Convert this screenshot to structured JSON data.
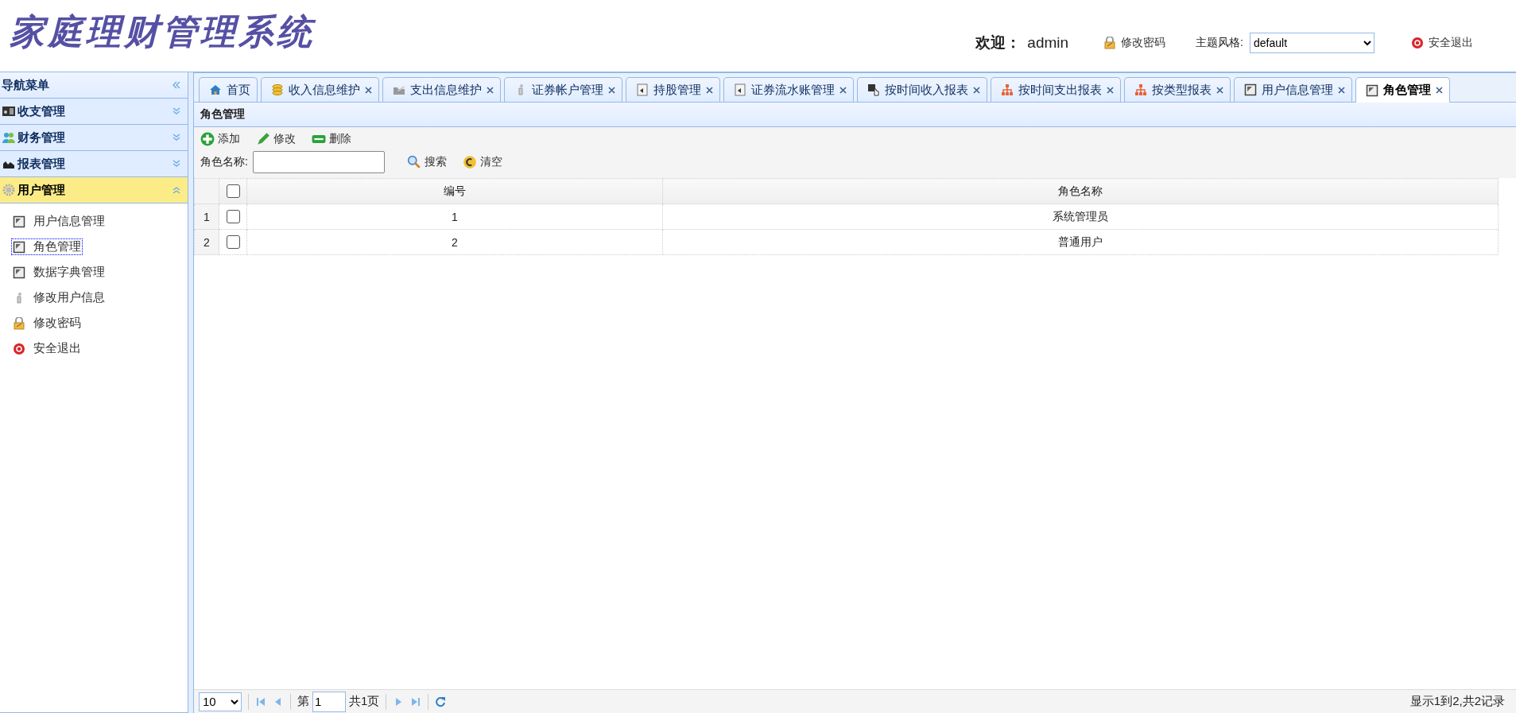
{
  "header": {
    "title": "家庭理财管理系统",
    "welcome_label": "欢迎：",
    "username": "admin",
    "change_password": "修改密码",
    "theme_label": "主题风格:",
    "theme_value": "default",
    "logout": "安全退出"
  },
  "sidebar": {
    "title": "导航菜单",
    "sections": [
      {
        "title": "收支管理",
        "expanded": false
      },
      {
        "title": "财务管理",
        "expanded": false
      },
      {
        "title": "报表管理",
        "expanded": false
      },
      {
        "title": "用户管理",
        "expanded": true,
        "items": [
          {
            "label": "用户信息管理",
            "selected": false
          },
          {
            "label": "角色管理",
            "selected": true
          },
          {
            "label": "数据字典管理",
            "selected": false
          },
          {
            "label": "修改用户信息",
            "selected": false
          },
          {
            "label": "修改密码",
            "selected": false
          },
          {
            "label": "安全退出",
            "selected": false
          }
        ]
      }
    ]
  },
  "tabs": [
    {
      "label": "首页",
      "closable": false,
      "selected": false
    },
    {
      "label": "收入信息维护",
      "closable": true,
      "selected": false
    },
    {
      "label": "支出信息维护",
      "closable": true,
      "selected": false
    },
    {
      "label": "证券帐户管理",
      "closable": true,
      "selected": false
    },
    {
      "label": "持股管理",
      "closable": true,
      "selected": false
    },
    {
      "label": "证券流水账管理",
      "closable": true,
      "selected": false
    },
    {
      "label": "按时间收入报表",
      "closable": true,
      "selected": false
    },
    {
      "label": "按时间支出报表",
      "closable": true,
      "selected": false
    },
    {
      "label": "按类型报表",
      "closable": true,
      "selected": false
    },
    {
      "label": "用户信息管理",
      "closable": true,
      "selected": false
    },
    {
      "label": "角色管理",
      "closable": true,
      "selected": true
    }
  ],
  "panel": {
    "title": "角色管理",
    "toolbar": [
      "添加",
      "修改",
      "删除"
    ],
    "search": {
      "label": "角色名称:",
      "search_button": "搜索",
      "clear_button": "清空"
    },
    "table": {
      "header_checked": false,
      "columns": [
        "编号",
        "角色名称"
      ],
      "rows": [
        {
          "number": "1",
          "checked": false,
          "cells": [
            "1",
            "系统管理员"
          ]
        },
        {
          "number": "2",
          "checked": false,
          "cells": [
            "2",
            "普通用户"
          ]
        }
      ]
    },
    "pager": {
      "page_size": "10",
      "page_prefix": "第",
      "page": "1",
      "page_total": "共1页",
      "summary": "显示1到2,共2记录"
    }
  }
}
